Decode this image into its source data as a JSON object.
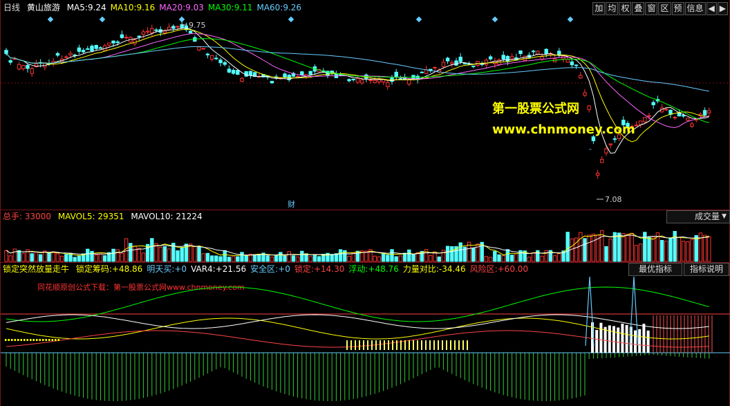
{
  "header": {
    "period": "日线",
    "stock_name": "黄山旅游",
    "ma": [
      {
        "label": "MA5:",
        "value": "9.24",
        "color": "#ffffff"
      },
      {
        "label": "MA10:",
        "value": "9.16",
        "color": "#ffff00"
      },
      {
        "label": "MA20:",
        "value": "9.03",
        "color": "#ff66ff"
      },
      {
        "label": "MA30:",
        "value": "9.11",
        "color": "#00ff00"
      },
      {
        "label": "MA60:",
        "value": "9.26",
        "color": "#66ccff"
      }
    ]
  },
  "toolbar": {
    "buttons": [
      "加",
      "均",
      "权",
      "叠",
      "窗",
      "区",
      "预",
      "信息"
    ],
    "arrows": [
      "◀",
      "▶"
    ]
  },
  "price_chart": {
    "high_label": "9.75",
    "low_label": "7.08",
    "cai_marker": "财",
    "dash_marker": "-"
  },
  "watermark": {
    "title": "第一股票公式网",
    "url": "www.chnmoney.com"
  },
  "volume": {
    "total_label": "总手:",
    "total_value": "33000",
    "mavol5_label": "MAVOL5:",
    "mavol5_value": "29351",
    "mavol10_label": "MAVOL10:",
    "mavol10_value": "21224",
    "dropdown": "成交量",
    "dropdown_arrow": "▼"
  },
  "indicator": {
    "name": "锁定突然放量走牛",
    "items": [
      {
        "label": "锁定筹码:",
        "value": "+48.86",
        "color": "#ffff00"
      },
      {
        "label": "明天买:",
        "value": "+0",
        "color": "#66ccff"
      },
      {
        "label": "VAR4:",
        "value": "+21.56",
        "color": "#ffffff"
      },
      {
        "label": "安全区:",
        "value": "+0",
        "color": "#66ccff"
      },
      {
        "label": "锁定:",
        "value": "+14.30",
        "color": "#ff4444"
      },
      {
        "label": "浮动:",
        "value": "+48.76",
        "color": "#00ff00"
      },
      {
        "label": "力量对比:",
        "value": "-34.46",
        "color": "#ffff00"
      },
      {
        "label": "风险区:",
        "value": "+60.00",
        "color": "#ff4444"
      }
    ],
    "best_btn": "最优指标",
    "explain_btn": "指标说明",
    "promo": "同花顺原创公式下载：第一股票公式网www.chnmoney.com"
  }
}
